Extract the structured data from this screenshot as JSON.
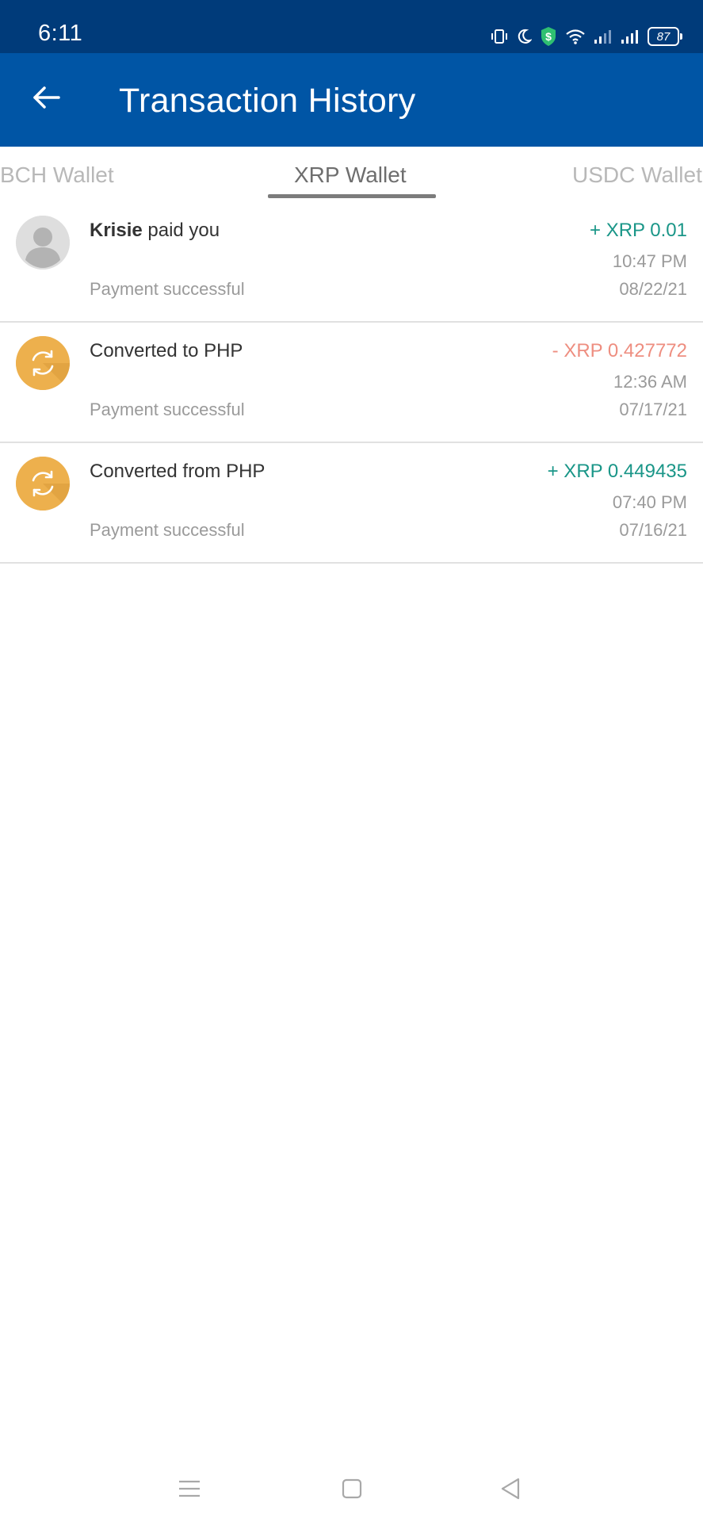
{
  "status_bar": {
    "time": "6:11",
    "battery": "87",
    "icons": [
      "vibrate-icon",
      "moon-icon",
      "shield-dollar-icon",
      "wifi-icon",
      "signal-icon",
      "signal-icon",
      "battery-icon"
    ]
  },
  "app_bar": {
    "title": "Transaction History",
    "back_icon": "arrow-left-icon",
    "background": "#0055a5"
  },
  "tabs": [
    {
      "label": "BCH Wallet",
      "active": false
    },
    {
      "label": "XRP Wallet",
      "active": true
    },
    {
      "label": "USDC Wallet",
      "active": false
    }
  ],
  "transactions": [
    {
      "icon": "user-avatar-icon",
      "title_bold": "Krisie",
      "title_rest": " paid you",
      "status": "Payment successful",
      "amount": "+ XRP 0.01",
      "direction": "positive",
      "time": "10:47 PM",
      "date": "08/22/21"
    },
    {
      "icon": "convert-icon",
      "title_bold": "",
      "title_rest": "Converted to PHP",
      "status": "Payment successful",
      "amount": "- XRP 0.427772",
      "direction": "negative",
      "time": "12:36 AM",
      "date": "07/17/21"
    },
    {
      "icon": "convert-icon",
      "title_bold": "",
      "title_rest": "Converted from PHP",
      "status": "Payment successful",
      "amount": "+ XRP 0.449435",
      "direction": "positive",
      "time": "07:40 PM",
      "date": "07/16/21"
    }
  ],
  "nav_bar": {
    "icons": [
      "menu-icon",
      "home-square-icon",
      "back-triangle-icon"
    ]
  },
  "colors": {
    "status_bar": "#003b7a",
    "app_bar": "#0055a5",
    "positive": "#1a9688",
    "negative": "#ee8e80",
    "convert_icon": "#edb04d"
  }
}
